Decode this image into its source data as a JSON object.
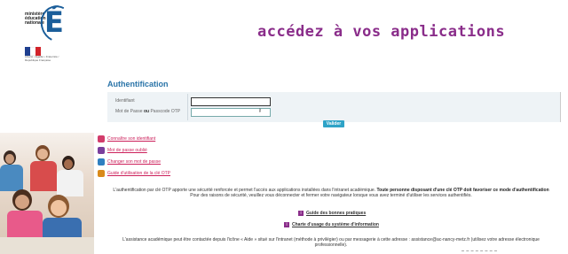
{
  "logo": {
    "lines": [
      "ministère",
      "éducation",
      "nationale"
    ],
    "letter": "É",
    "small": "Liberté • Égalité • Fraternité / République Française"
  },
  "tagline": "accédez à vos applications",
  "auth": {
    "title": "Authentification",
    "identifiant_label": "Identifiant",
    "password_label_pre": "Mot de Passe",
    "password_label_ou": "ou",
    "password_label_post": "Passcode OTP",
    "identifiant_value": "",
    "password_value": "",
    "submit_label": "Valider"
  },
  "links": [
    {
      "label": "Connaître son identifiant",
      "icon_color": "#d23c6b"
    },
    {
      "label": "Mot de passe oublié",
      "icon_color": "#7a3e9c"
    },
    {
      "label": "Changer son mot de passe",
      "icon_color": "#2f7fc0"
    },
    {
      "label": "Guide d'utilisation de la clé OTP",
      "icon_color": "#d98a1a"
    }
  ],
  "info": {
    "line1_pre": "L'authentification par clé OTP apporte une sécurité renforcée et permet l'accès aux applications installées dans l'intranet académique.",
    "line1_bold": "Toute personne disposant d'une clé OTP doit favoriser ce mode d'authentification",
    "line2": "Pour des raisons de sécurité, veuillez vous déconnecter et fermer votre navigateur lorsque vous avez terminé d'utiliser les services authentifiés."
  },
  "guides": {
    "bonnes_pratiques": "Guide des bonnes pratiques",
    "charte": "Charte d'usage du système d'information"
  },
  "footer": {
    "line1": "L'assistance académique peut être contactée depuis l'icône « Aide » situé sur l'intranet (méthode à privilégier) ou par messagerie à cette adresse : assistance@ac-nancy-metz.fr (utilisez votre adresse électronique",
    "line2": "professionnelle)."
  },
  "colors": {
    "accent": "#2a74a8",
    "tagline": "#8a2d8a",
    "link": "#cc1f5a",
    "button": "#2ea3c7"
  }
}
